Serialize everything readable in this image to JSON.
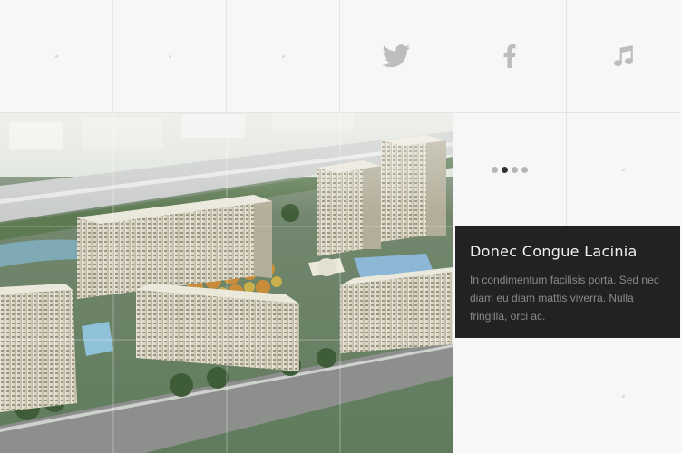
{
  "social": {
    "icons": [
      "twitter-icon",
      "facebook-icon",
      "music-icon"
    ]
  },
  "slider": {
    "dots": 4,
    "active_index": 1
  },
  "caption": {
    "title": "Donec Congue Lacinia",
    "text": "In condimentum facilisis porta. Sed nec diam eu diam mattis viverra. Nulla fringilla, orci ac."
  },
  "colors": {
    "background": "#f7f7f7",
    "caption_bg": "#222222",
    "icon_gray": "#bdbdbd"
  }
}
